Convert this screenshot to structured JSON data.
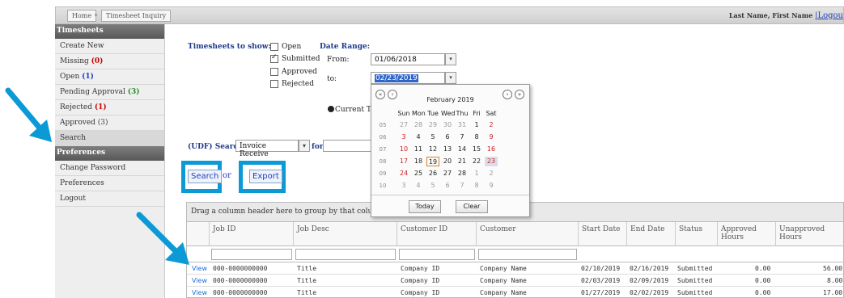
{
  "breadcrumb": {
    "home": "Home",
    "separator": "»",
    "current": "Timesheet Inquiry"
  },
  "user": {
    "name": "Last Name, First Name",
    "logout": "|Logou"
  },
  "sidebar": {
    "sections": [
      {
        "title": "Timesheets",
        "items": [
          {
            "label": "Create New",
            "count": ""
          },
          {
            "label": "Missing",
            "count": "(0)"
          },
          {
            "label": "Open",
            "count": "(1)"
          },
          {
            "label": "Pending Approval",
            "count": "(3)"
          },
          {
            "label": "Rejected",
            "count": "(1)"
          },
          {
            "label": "Approved",
            "count": "(3)"
          },
          {
            "label": "Search",
            "count": ""
          }
        ]
      },
      {
        "title": "Preferences",
        "items": [
          {
            "label": "Change Password"
          },
          {
            "label": "Preferences"
          },
          {
            "label": "Logout"
          }
        ]
      }
    ]
  },
  "filters": {
    "show_label": "Timesheets to show:",
    "options": [
      "Open",
      "Submitted",
      "Approved",
      "Rejected"
    ],
    "date_range_label": "Date Range:",
    "from_label": "From:",
    "from_value": "01/06/2018",
    "to_label": "to:",
    "to_value": "02/23/2019",
    "current_label": "Current Tim",
    "udf_label": "(UDF) Search",
    "udf_select": "Invoice Receive",
    "for_label": "for"
  },
  "actions": {
    "search": "Search",
    "hidden_fragment": "or",
    "export": "Export"
  },
  "calendar": {
    "nav": [
      "«",
      "‹",
      "›",
      "»"
    ],
    "title": "February 2019",
    "dow": [
      "Sun",
      "Mon",
      "Tue",
      "Wed",
      "Thu",
      "Fri",
      "Sat"
    ],
    "weeks": [
      {
        "wk": "05",
        "days": [
          "27",
          "28",
          "29",
          "30",
          "31",
          "1",
          "2"
        ]
      },
      {
        "wk": "06",
        "days": [
          "3",
          "4",
          "5",
          "6",
          "7",
          "8",
          "9"
        ]
      },
      {
        "wk": "07",
        "days": [
          "10",
          "11",
          "12",
          "13",
          "14",
          "15",
          "16"
        ]
      },
      {
        "wk": "08",
        "days": [
          "17",
          "18",
          "19",
          "20",
          "21",
          "22",
          "23"
        ]
      },
      {
        "wk": "09",
        "days": [
          "24",
          "25",
          "26",
          "27",
          "28",
          "1",
          "2"
        ]
      },
      {
        "wk": "10",
        "days": [
          "3",
          "4",
          "5",
          "6",
          "7",
          "8",
          "9"
        ]
      }
    ],
    "today_btn": "Today",
    "clear_btn": "Clear"
  },
  "grid": {
    "group_hint": "Drag a column header here to group by that column",
    "columns": [
      "",
      "Job ID",
      "Job Desc",
      "Customer ID",
      "Customer",
      "Start Date",
      "End Date",
      "Status",
      "Approved Hours",
      "Unapproved Hours"
    ],
    "rows": [
      [
        "View",
        "000-0000000000",
        "Title",
        "Company ID",
        "Company Name",
        "02/10/2019",
        "02/16/2019",
        "Submitted",
        "0.00",
        "56.00"
      ],
      [
        "View",
        "000-0000000000",
        "Title",
        "Company ID",
        "Company Name",
        "02/03/2019",
        "02/09/2019",
        "Submitted",
        "0.00",
        "8.00"
      ],
      [
        "View",
        "000-0000000000",
        "Title",
        "Company ID",
        "Company Name",
        "01/27/2019",
        "02/02/2019",
        "Submitted",
        "0.00",
        "17.00"
      ]
    ]
  },
  "colors": {
    "highlight": "#0b9ad6",
    "header_blue": "#1f3a8a",
    "weekend_red": "#cc2222"
  }
}
